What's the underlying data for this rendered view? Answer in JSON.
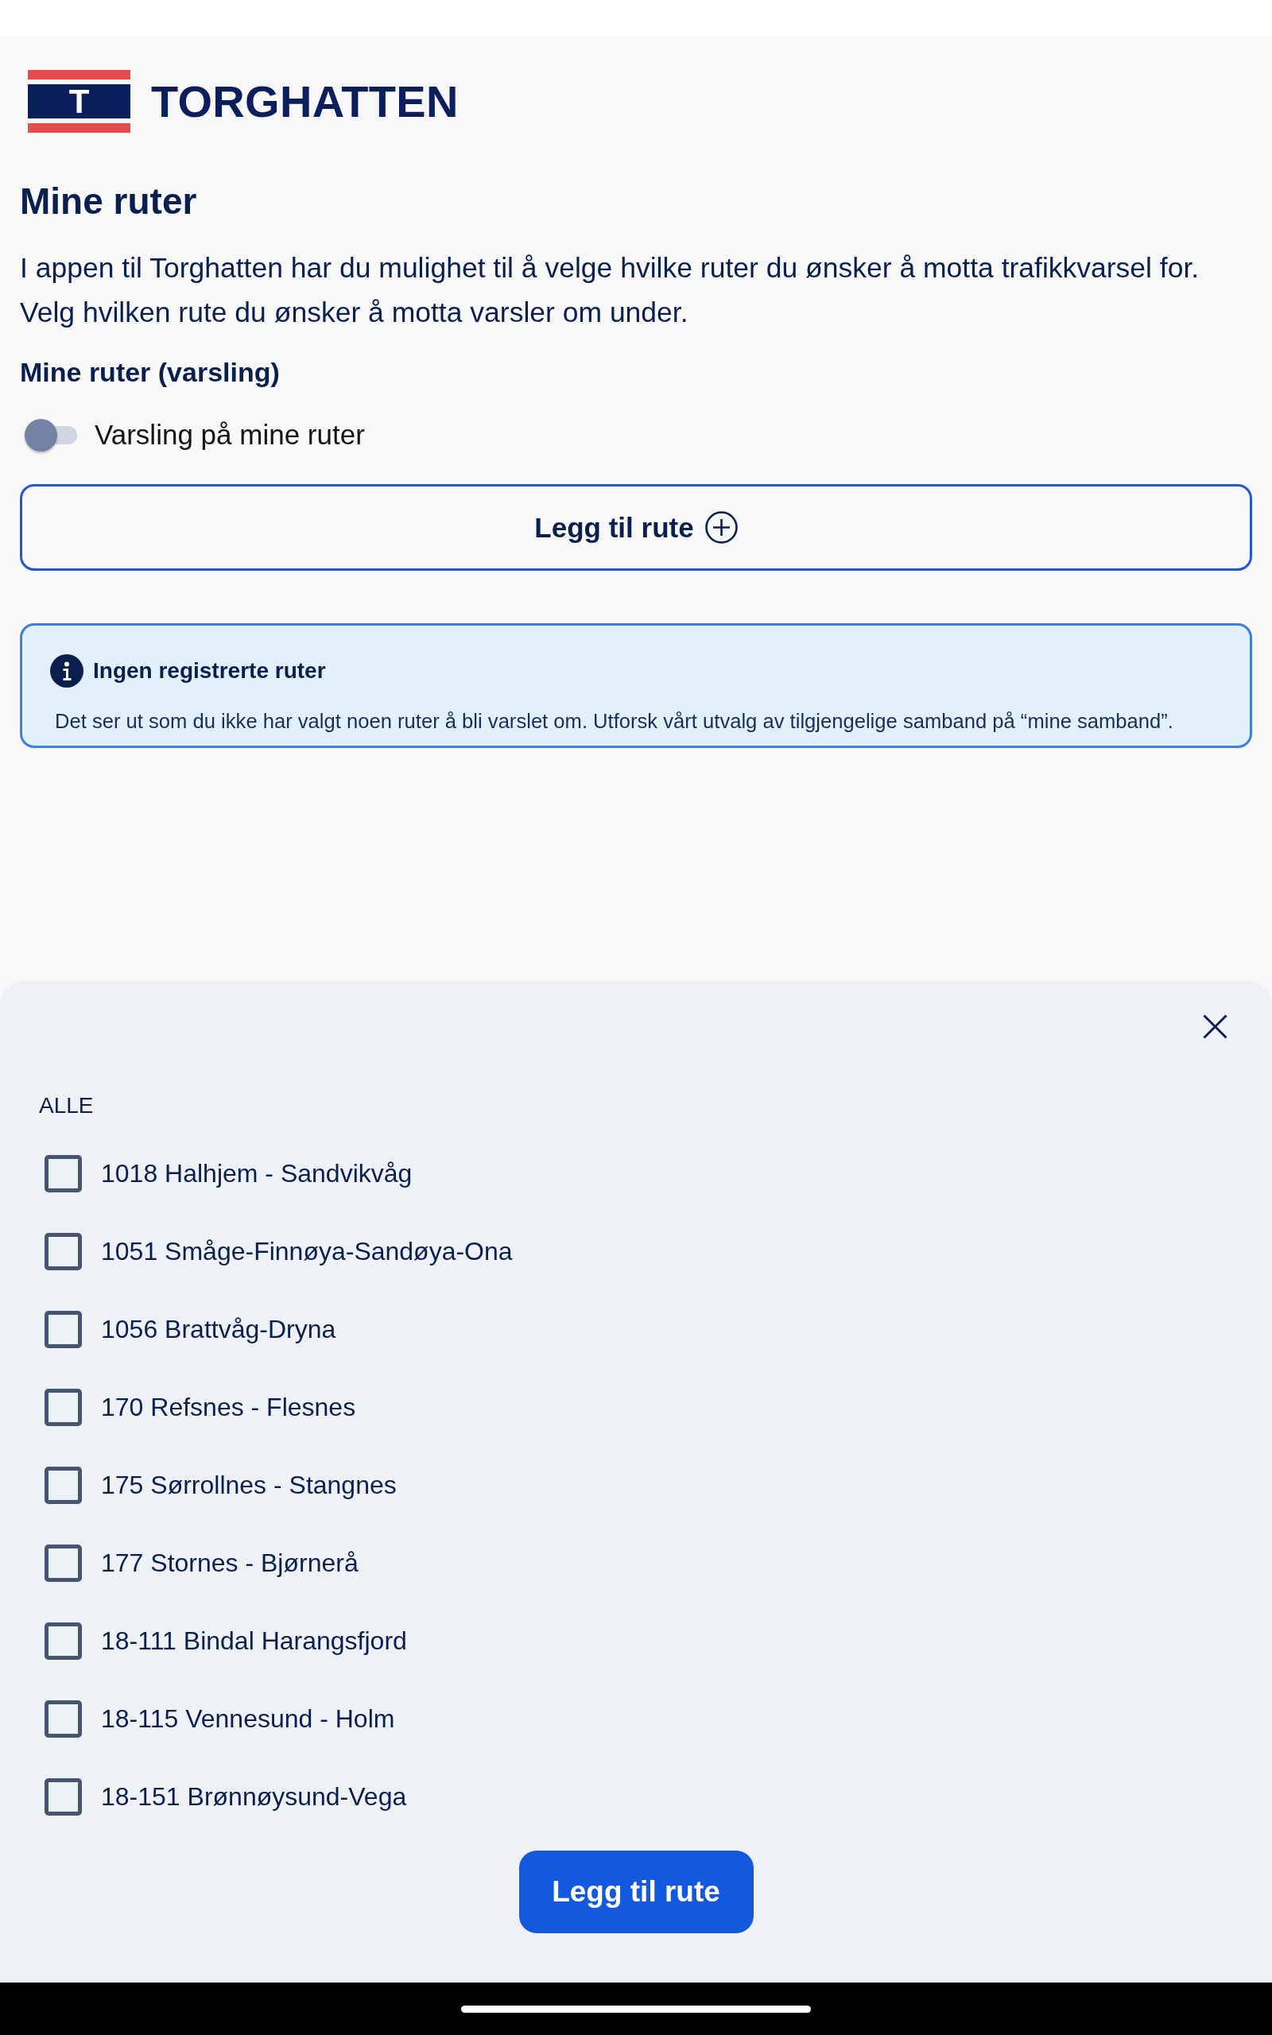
{
  "logo": {
    "flag_letter": "T",
    "wordmark": "TORGHATTEN"
  },
  "page": {
    "title": "Mine ruter",
    "intro": [
      "I appen til Torghatten har du mulighet til å velge hvilke ruter du ønsker å motta trafikkvarsel for.",
      "Velg hvilken rute du ønsker å motta varsler om under."
    ],
    "section_title": "Mine ruter (varsling)",
    "toggle": {
      "label": "Varsling på mine ruter",
      "on": false
    },
    "add_button": "Legg til rute",
    "notice": {
      "title": "Ingen registrerte ruter",
      "text": "Det ser ut som du ikke har valgt noen ruter å bli varslet om. Utforsk vårt utvalg av tilgjengelige samband på “mine samband”."
    }
  },
  "sheet": {
    "group_label": "ALLE",
    "routes": [
      {
        "label": "1018 Halhjem - Sandvikvåg",
        "checked": false
      },
      {
        "label": "1051 Småge-Finnøya-Sandøya-Ona",
        "checked": false
      },
      {
        "label": "1056 Brattvåg-Dryna",
        "checked": false
      },
      {
        "label": "170 Refsnes - Flesnes",
        "checked": false
      },
      {
        "label": "175 Sørrollnes - Stangnes",
        "checked": false
      },
      {
        "label": "177 Stornes - Bjørnerå",
        "checked": false
      },
      {
        "label": "18-111 Bindal Harangsfjord",
        "checked": false
      },
      {
        "label": "18-115 Vennesund - Holm",
        "checked": false
      },
      {
        "label": "18-151 Brønnøysund-Vega",
        "checked": false
      }
    ],
    "submit_button": "Legg til rute"
  }
}
